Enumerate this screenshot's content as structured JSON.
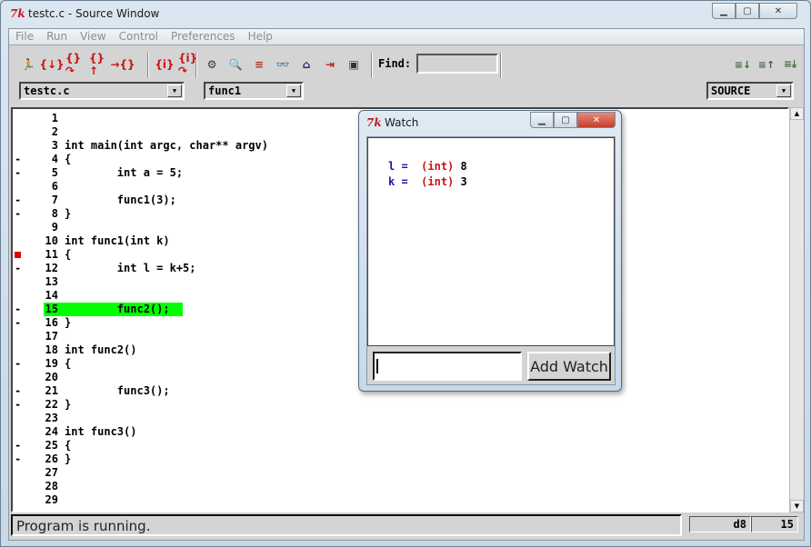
{
  "window": {
    "title": "testc.c - Source Window",
    "logo": "7k"
  },
  "menus": [
    "File",
    "Run",
    "View",
    "Control",
    "Preferences",
    "Help"
  ],
  "toolbar": {
    "buttons": [
      {
        "name": "run-icon",
        "glyph": "🏃",
        "color": "#1a1aa0"
      },
      {
        "name": "step-icon",
        "glyph": "{↓}",
        "color": "#c81414"
      },
      {
        "name": "next-icon",
        "glyph": "{}↷",
        "color": "#c81414"
      },
      {
        "name": "finish-icon",
        "glyph": "{}↑",
        "color": "#c81414"
      },
      {
        "name": "continue-icon",
        "glyph": "→{}",
        "color": "#c81414"
      },
      {
        "name": "stepi-icon",
        "glyph": "{i}",
        "color": "#c81414"
      },
      {
        "name": "nexti-icon",
        "glyph": "{i}↷",
        "color": "#c81414"
      },
      {
        "name": "registers-icon",
        "glyph": "⚙",
        "color": "#333"
      },
      {
        "name": "memory-search-icon",
        "glyph": "🔍",
        "color": "#333"
      },
      {
        "name": "stack-icon",
        "glyph": "≡",
        "color": "#b0302a"
      },
      {
        "name": "watch-glasses-icon",
        "glyph": "👓",
        "color": "#333"
      },
      {
        "name": "home-icon",
        "glyph": "⌂",
        "color": "#1a2a80"
      },
      {
        "name": "goto-line-icon",
        "glyph": "⇥",
        "color": "#c81414"
      },
      {
        "name": "console-icon",
        "glyph": "▣",
        "color": "#333"
      }
    ],
    "find_label": "Find:",
    "find_value": "",
    "right_buttons": [
      {
        "name": "frame-down-icon",
        "glyph": "≡↓"
      },
      {
        "name": "frame-up-icon",
        "glyph": "≡↑"
      },
      {
        "name": "frame-bottom-icon",
        "glyph": "≡⤓"
      }
    ]
  },
  "file_combo": "testc.c",
  "function_combo": "func1",
  "mode_combo": "SOURCE",
  "source": {
    "current_line": 15,
    "lines": [
      {
        "n": "1",
        "code": "",
        "mark": ""
      },
      {
        "n": "2",
        "code": "",
        "mark": ""
      },
      {
        "n": "3",
        "code": "int main(int argc, char** argv)",
        "mark": ""
      },
      {
        "n": "4",
        "code": "{",
        "mark": "-"
      },
      {
        "n": "5",
        "code": "        int a = 5;",
        "mark": "-"
      },
      {
        "n": "6",
        "code": "",
        "mark": ""
      },
      {
        "n": "7",
        "code": "        func1(3);",
        "mark": "-"
      },
      {
        "n": "8",
        "code": "}",
        "mark": "-"
      },
      {
        "n": "9",
        "code": "",
        "mark": ""
      },
      {
        "n": "10",
        "code": "int func1(int k)",
        "mark": ""
      },
      {
        "n": "11",
        "code": "{",
        "mark": "bp"
      },
      {
        "n": "12",
        "code": "        int l = k+5;",
        "mark": "-"
      },
      {
        "n": "13",
        "code": "",
        "mark": ""
      },
      {
        "n": "14",
        "code": "",
        "mark": ""
      },
      {
        "n": "15",
        "code": "        func2();",
        "mark": "-"
      },
      {
        "n": "16",
        "code": "}",
        "mark": "-"
      },
      {
        "n": "17",
        "code": "",
        "mark": ""
      },
      {
        "n": "18",
        "code": "int func2()",
        "mark": ""
      },
      {
        "n": "19",
        "code": "{",
        "mark": "-"
      },
      {
        "n": "20",
        "code": "",
        "mark": ""
      },
      {
        "n": "21",
        "code": "        func3();",
        "mark": "-"
      },
      {
        "n": "22",
        "code": "}",
        "mark": "-"
      },
      {
        "n": "23",
        "code": "",
        "mark": ""
      },
      {
        "n": "24",
        "code": "int func3()",
        "mark": ""
      },
      {
        "n": "25",
        "code": "{",
        "mark": "-"
      },
      {
        "n": "26",
        "code": "}",
        "mark": "-"
      },
      {
        "n": "27",
        "code": "",
        "mark": ""
      },
      {
        "n": "28",
        "code": "",
        "mark": ""
      },
      {
        "n": "29",
        "code": "",
        "mark": ""
      }
    ]
  },
  "status": {
    "message": "Program is running.",
    "address": "d8",
    "line": "15"
  },
  "watch": {
    "title": "Watch",
    "items": [
      {
        "name": "l",
        "type": "(int)",
        "value": "8"
      },
      {
        "name": "k",
        "type": "(int)",
        "value": "3"
      }
    ],
    "input_value": "",
    "add_label": "Add Watch"
  },
  "colors": {
    "highlight": "#00ff00",
    "breakpoint": "#e00000",
    "watch_name": "#1a1a9a",
    "watch_type": "#c81414"
  }
}
